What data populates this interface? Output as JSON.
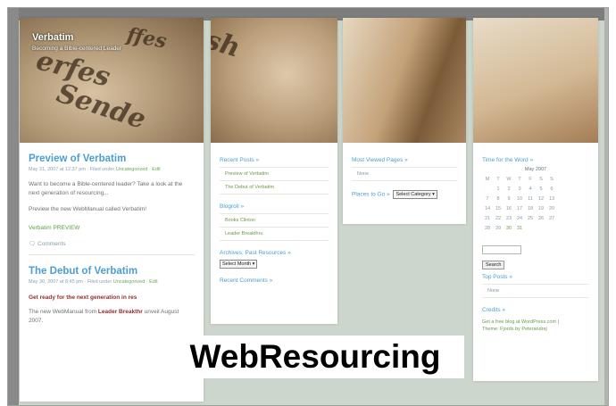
{
  "blog": {
    "title": "Verbatim",
    "tagline": "Becoming a Bible-centered Leader"
  },
  "posts": [
    {
      "title": "Preview of Verbatim",
      "meta": "May 31, 2007 at 12:37 pm · Filed under",
      "category": "Uncategorized",
      "edit": "Edit",
      "body1": "Want to become a Bible-centered leader? Take a look at the next generation of resourcing...",
      "body2": "Preview the new WebManual called Verbatim!",
      "link": "Verbatim PREVIEW",
      "comments": "Comments"
    },
    {
      "title": "The Debut of Verbatim",
      "meta": "May 30, 2007 at 8:45 pm · Filed under",
      "category": "Uncategorized",
      "edit": "Edit",
      "highlight": "Get ready for the next generation in res",
      "body_pre": "The new WebManual from",
      "body_link": "Leader Breakthr",
      "body_post": "unveil August 2007."
    }
  ],
  "sidebar_recent": {
    "heading": "Recent Posts",
    "items": [
      "Preview of Verbatim",
      "The Debut of Verbatim"
    ]
  },
  "sidebar_blogroll": {
    "heading": "Blogroll",
    "items": [
      "Books Clinton",
      "Leader Breakthru"
    ]
  },
  "sidebar_archives": {
    "heading": "Archives: Past Resources",
    "select": "Select Month"
  },
  "sidebar_recent_comments": {
    "heading": "Recent Comments"
  },
  "most_viewed": {
    "heading": "Most Viewed Pages",
    "item": "None"
  },
  "places": {
    "label": "Places to Go",
    "select": "Select Category"
  },
  "calendar": {
    "heading": "Time for the Word",
    "month": "May 2007",
    "weekdays": [
      "M",
      "T",
      "W",
      "T",
      "F",
      "S",
      "S"
    ],
    "rows": [
      [
        "",
        "1",
        "2",
        "3",
        "4",
        "5",
        "6"
      ],
      [
        "7",
        "8",
        "9",
        "10",
        "11",
        "12",
        "13"
      ],
      [
        "14",
        "15",
        "16",
        "17",
        "18",
        "19",
        "20"
      ],
      [
        "21",
        "22",
        "23",
        "24",
        "25",
        "26",
        "27"
      ],
      [
        "28",
        "29",
        "30",
        "31",
        "",
        "",
        ""
      ]
    ]
  },
  "search": {
    "button": "Search"
  },
  "top_posts": {
    "heading": "Top Posts",
    "item": "None"
  },
  "credits": {
    "heading": "Credits",
    "line1": "Get a free blog at WordPress.com |",
    "line2": "Theme: Fjords by Peterandrej"
  },
  "banner": {
    "text": "WebResourcing"
  },
  "colors": {
    "heading_blue": "#4a9fcf",
    "link_green": "#5aa040",
    "accent_red": "#9a2a2a"
  }
}
